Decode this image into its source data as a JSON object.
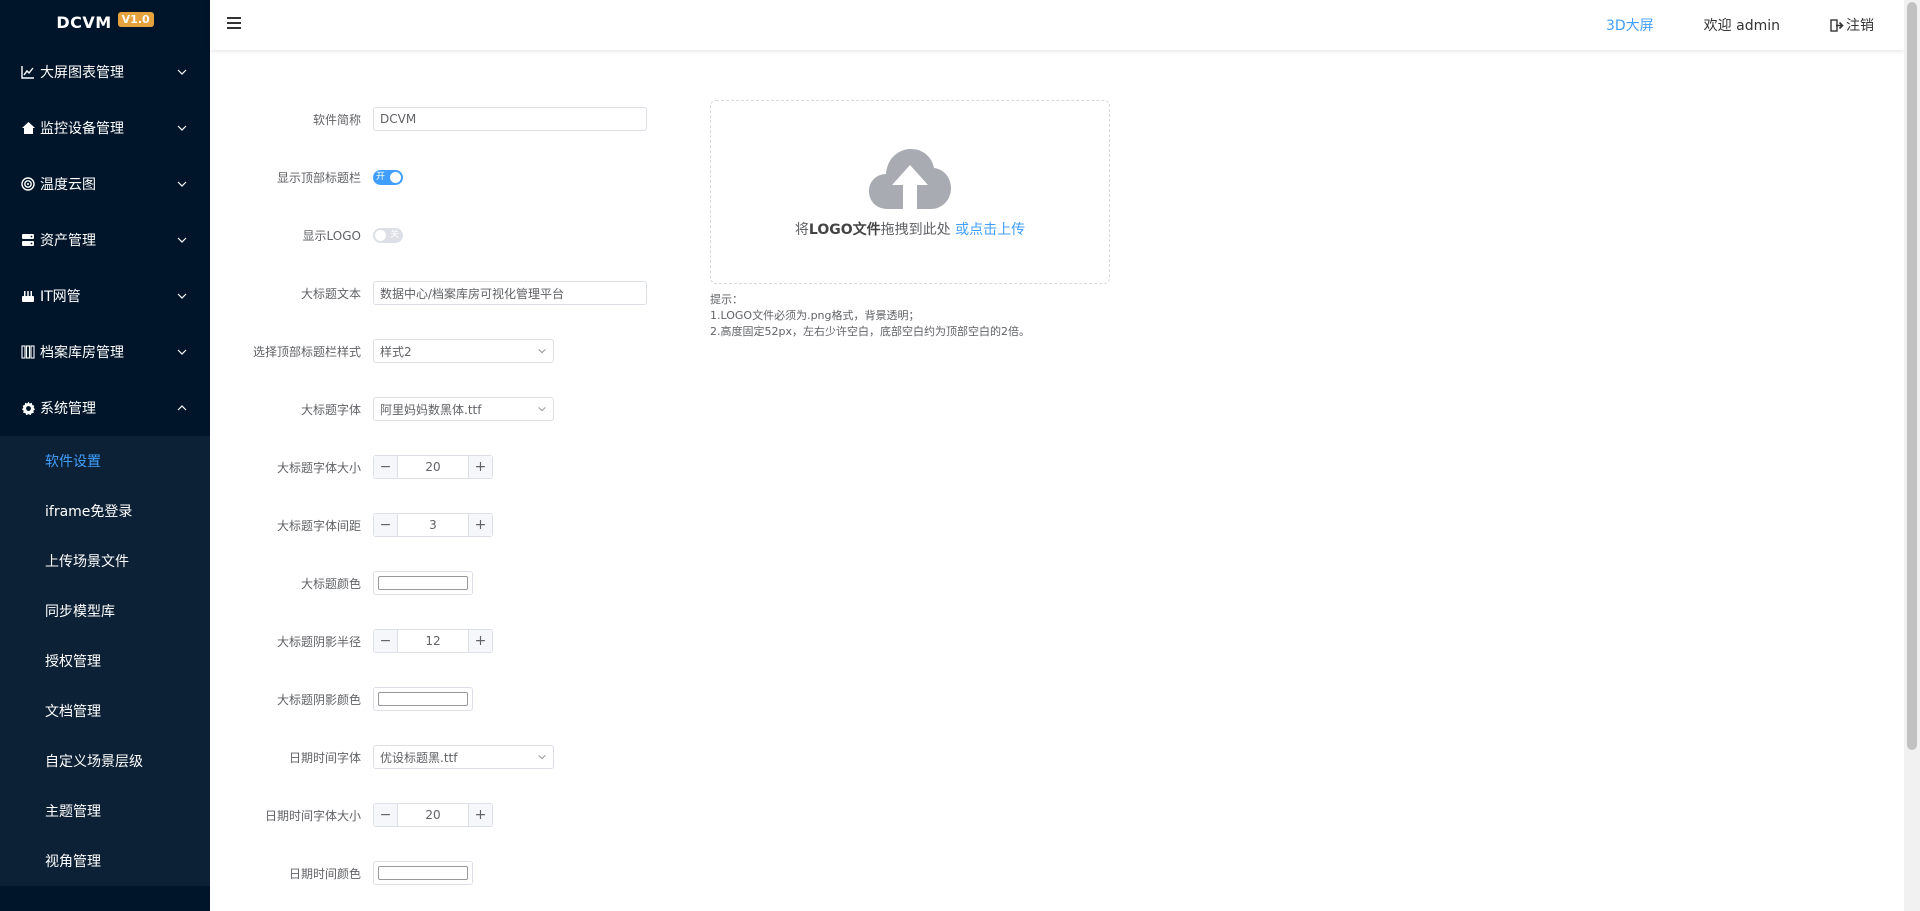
{
  "brand": {
    "name": "DCVM",
    "version": "V1.0"
  },
  "menu": [
    {
      "label": "大屏图表管理",
      "icon": "chart-line-icon"
    },
    {
      "label": "监控设备管理",
      "icon": "home-icon"
    },
    {
      "label": "温度云图",
      "icon": "target-icon"
    },
    {
      "label": "资产管理",
      "icon": "server-icon"
    },
    {
      "label": "IT网管",
      "icon": "network-icon"
    },
    {
      "label": "档案库房管理",
      "icon": "grid-icon"
    },
    {
      "label": "系统管理",
      "icon": "gear-icon"
    }
  ],
  "submenu": [
    {
      "label": "软件设置",
      "active": true
    },
    {
      "label": "iframe免登录"
    },
    {
      "label": "上传场景文件"
    },
    {
      "label": "同步模型库"
    },
    {
      "label": "授权管理"
    },
    {
      "label": "文档管理"
    },
    {
      "label": "自定义场景层级"
    },
    {
      "label": "主题管理"
    },
    {
      "label": "视角管理"
    }
  ],
  "header": {
    "screen_3d": "3D大屏",
    "welcome": "欢迎 admin",
    "logout": "注销"
  },
  "form": {
    "software_name": {
      "label": "软件简称",
      "value": "DCVM"
    },
    "show_title_bar": {
      "label": "显示顶部标题栏",
      "on": true,
      "on_text": "开"
    },
    "show_logo": {
      "label": "显示LOGO",
      "on": false,
      "off_text": "关"
    },
    "title_text": {
      "label": "大标题文本",
      "value": "数据中心/档案库房可视化管理平台"
    },
    "title_bar_style": {
      "label": "选择顶部标题栏样式",
      "value": "样式2"
    },
    "title_font": {
      "label": "大标题字体",
      "value": "阿里妈妈数黑体.ttf"
    },
    "title_font_size": {
      "label": "大标题字体大小",
      "value": "20"
    },
    "title_letter_spacing": {
      "label": "大标题字体间距",
      "value": "3"
    },
    "title_color": {
      "label": "大标题颜色",
      "color": "#ffffff"
    },
    "title_shadow_radius": {
      "label": "大标题阴影半径",
      "value": "12"
    },
    "title_shadow_color": {
      "label": "大标题阴影颜色",
      "color": "#ffffff"
    },
    "datetime_font": {
      "label": "日期时间字体",
      "value": "优设标题黑.ttf"
    },
    "datetime_font_size": {
      "label": "日期时间字体大小",
      "value": "20"
    },
    "datetime_color": {
      "label": "日期时间颜色",
      "color": "#ffffff"
    }
  },
  "upload": {
    "prefix": "将",
    "bold": "LOGO文件",
    "middle": "拖拽到此处 ",
    "link": "或点击上传"
  },
  "tips": {
    "title": "提示：",
    "line1": "1.LOGO文件必须为.png格式，背景透明；",
    "line2": "2.高度固定52px，左右少许空白，底部空白约为顶部空白的2倍。"
  }
}
